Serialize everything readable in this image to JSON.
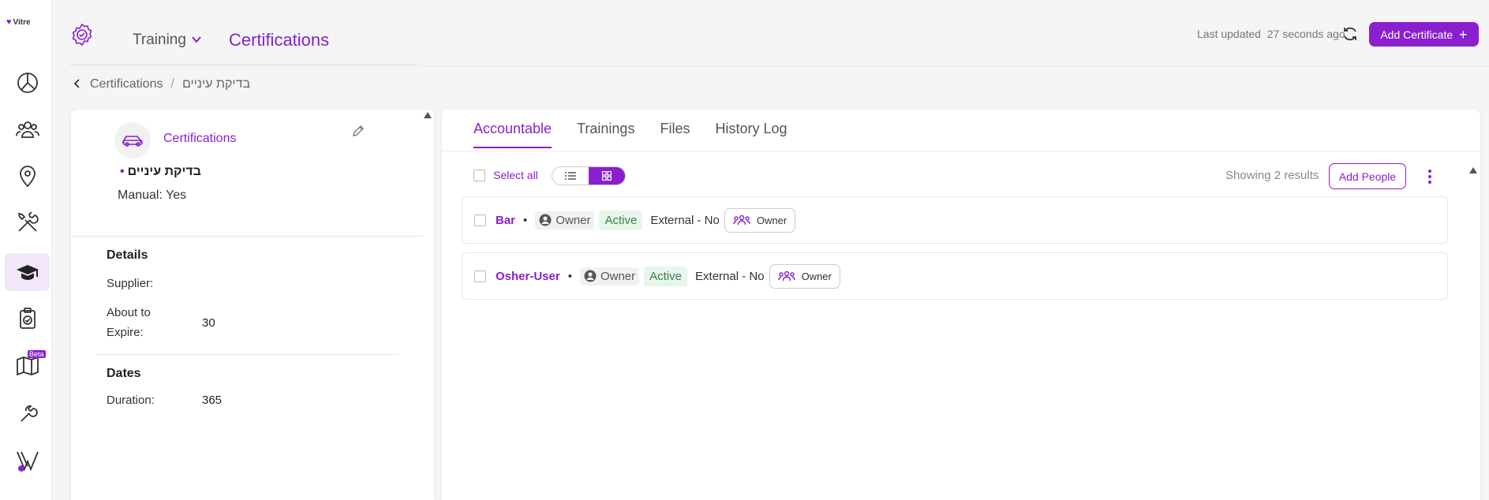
{
  "logo": {
    "text": "Vitre"
  },
  "rail": {
    "beta_label": "Beta"
  },
  "header": {
    "crumb_module": "Training",
    "title": "Certifications",
    "last_updated_label": "Last updated",
    "last_updated_value": "27 seconds ago",
    "add_certificate_label": "Add Certificate"
  },
  "breadcrumb": {
    "parent": "Certifications",
    "separator": "/",
    "current": "בדיקת עיניים"
  },
  "left_panel": {
    "category": "Certifications",
    "name": "בדיקת עיניים",
    "manual": "Manual: Yes",
    "details_heading": "Details",
    "supplier_label": "Supplier:",
    "supplier_value": "",
    "about_to_expire_label": "About to Expire:",
    "about_to_expire_value": "30",
    "dates_heading": "Dates",
    "duration_label": "Duration:",
    "duration_value": "365"
  },
  "tabs": [
    "Accountable",
    "Trainings",
    "Files",
    "History Log"
  ],
  "toolbar": {
    "select_all": "Select all",
    "showing": "Showing 2 results",
    "add_people": "Add People"
  },
  "rows": [
    {
      "name": "Bar",
      "role": "Owner",
      "status": "Active",
      "external": "External - No",
      "group": "Owner"
    },
    {
      "name": "Osher-User",
      "role": "Owner",
      "status": "Active",
      "external": "External - No",
      "group": "Owner"
    }
  ],
  "colors": {
    "accent": "#8a1fcf",
    "active_bg": "#e6f6ea",
    "active_text": "#3a7d4e"
  }
}
